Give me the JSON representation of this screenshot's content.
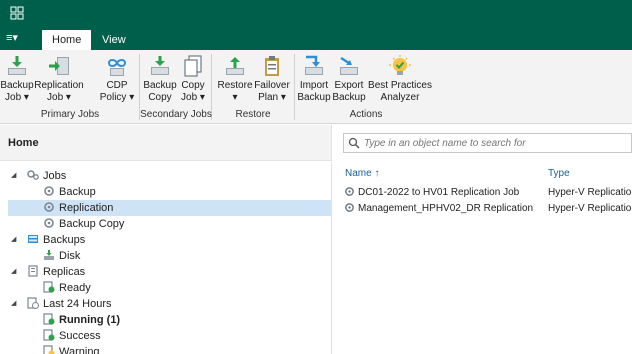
{
  "menu": {
    "label": "≡▾"
  },
  "tabs": [
    {
      "label": "Home"
    },
    {
      "label": "View"
    }
  ],
  "ribbon": {
    "backup_job": [
      "Backup",
      "Job ▾"
    ],
    "replication_job": [
      "Replication",
      "Job ▾"
    ],
    "cdp_policy": [
      "CDP",
      "Policy ▾"
    ],
    "backup_copy": [
      "Backup",
      "Copy"
    ],
    "copy_job": [
      "Copy",
      "Job ▾"
    ],
    "restore": [
      "Restore",
      "▾"
    ],
    "failover_plan": [
      "Failover",
      "Plan ▾"
    ],
    "import_backup": [
      "Import",
      "Backup"
    ],
    "export_backup": [
      "Export",
      "Backup"
    ],
    "best_practices": [
      "Best Practices",
      "Analyzer"
    ],
    "groups": [
      "Primary Jobs",
      "Secondary Jobs",
      "Restore",
      "Actions"
    ]
  },
  "left": {
    "header": "Home",
    "tree": [
      {
        "label": "Jobs"
      },
      {
        "label": "Backup"
      },
      {
        "label": "Replication"
      },
      {
        "label": "Backup Copy"
      },
      {
        "label": "Backups"
      },
      {
        "label": "Disk"
      },
      {
        "label": "Replicas"
      },
      {
        "label": "Ready"
      },
      {
        "label": "Last 24 Hours"
      },
      {
        "label": "Running (1)"
      },
      {
        "label": "Success"
      },
      {
        "label": "Warning"
      }
    ]
  },
  "right": {
    "search_placeholder": "Type in an object name to search for",
    "columns": {
      "name": "Name ↑",
      "type": "Type"
    },
    "rows": [
      {
        "name": "DC01-2022 to HV01 Replication Job",
        "type": "Hyper-V Replication"
      },
      {
        "name": "Management_HPHV02_DR Replication",
        "type": "Hyper-V Replication"
      }
    ]
  },
  "colors": {
    "titlebar": "#005f4b",
    "accent": "#1a5fa0",
    "selection": "#cfe3f6"
  }
}
